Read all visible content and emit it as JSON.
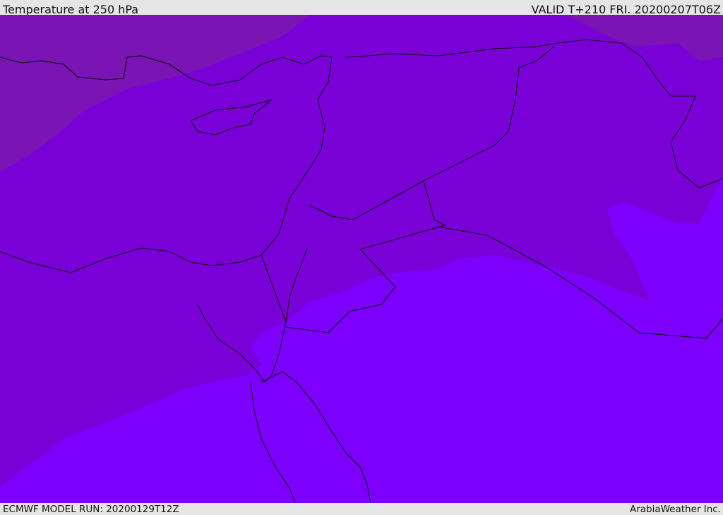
{
  "header": {
    "title": "Temperature at 250 hPa",
    "valid": "VALID T+210 FRI. 20200207T06Z"
  },
  "footer": {
    "model_run": "ECMWF MODEL RUN: 20200129T12Z",
    "credit": "ArabiaWeather Inc."
  },
  "colors": {
    "band_cold": "#7a14b4",
    "band_mid": "#7a00d8",
    "band_warm": "#7d00ff",
    "borders": "#000000"
  }
}
